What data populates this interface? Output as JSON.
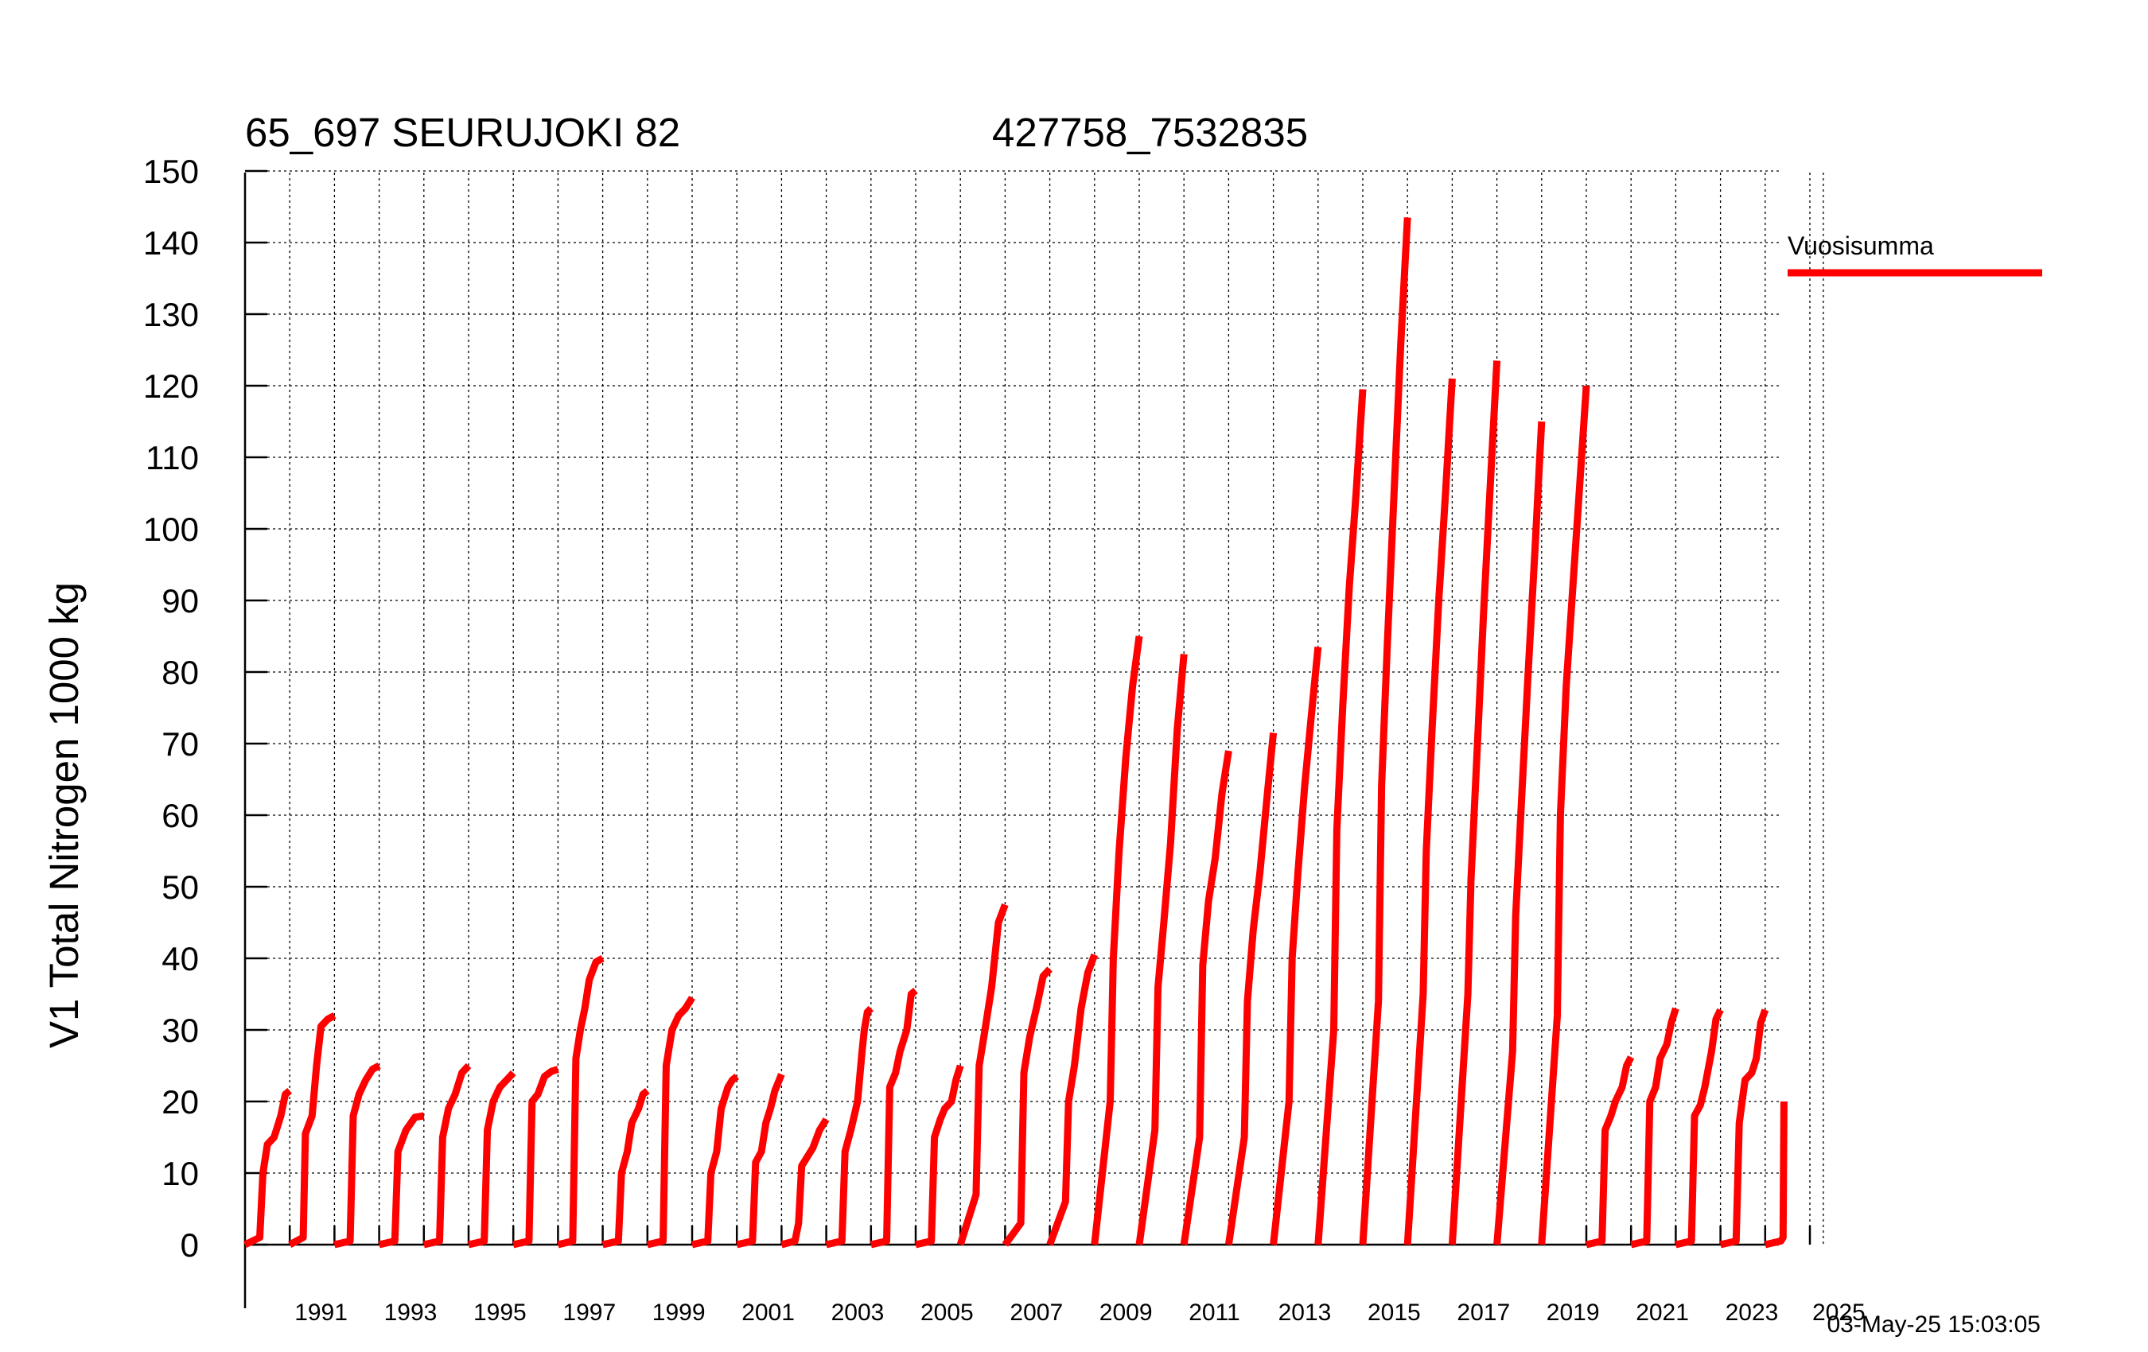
{
  "header": {
    "title_left": "65_697 SEURUJOKI 82",
    "title_right": "427758_7532835"
  },
  "timestamp": "03-May-25 15:03:05",
  "legend": {
    "label": "Vuosisumma",
    "color": "#ff0000",
    "placement": "right"
  },
  "chart_data": {
    "type": "line",
    "title": "65_697 SEURUJOKI 82",
    "ylabel": "V1 Total Nitrogen 1000 kg",
    "xlabel": "",
    "ylim": [
      0,
      150
    ],
    "yticks": [
      0,
      10,
      20,
      30,
      40,
      50,
      60,
      70,
      80,
      90,
      100,
      110,
      120,
      130,
      140,
      150
    ],
    "xlim": [
      1990,
      2025.3
    ],
    "xtick_labels": [
      "1991",
      "1993",
      "1995",
      "1997",
      "1999",
      "2001",
      "2003",
      "2005",
      "2007",
      "2009",
      "2011",
      "2013",
      "2015",
      "2017",
      "2019",
      "2021",
      "2023",
      "2025"
    ],
    "grid": true,
    "series": [
      {
        "name": "Vuosisumma",
        "color": "#ff0000",
        "description_of_x": "decimal year",
        "segments": [
          [
            [
              1990.0,
              0
            ],
            [
              1990.33,
              1
            ],
            [
              1990.4,
              10
            ],
            [
              1990.5,
              14
            ],
            [
              1990.65,
              15
            ],
            [
              1990.8,
              18
            ],
            [
              1990.9,
              21
            ],
            [
              1991.0,
              21.5
            ]
          ],
          [
            [
              1991.0,
              0
            ],
            [
              1991.3,
              1
            ],
            [
              1991.35,
              15.5
            ],
            [
              1991.5,
              18
            ],
            [
              1991.6,
              25
            ],
            [
              1991.7,
              30.5
            ],
            [
              1991.85,
              31.5
            ],
            [
              1992.0,
              32
            ]
          ],
          [
            [
              1992.0,
              0
            ],
            [
              1992.35,
              0.5
            ],
            [
              1992.42,
              18
            ],
            [
              1992.55,
              21
            ],
            [
              1992.7,
              23
            ],
            [
              1992.85,
              24.5
            ],
            [
              1993.0,
              25
            ]
          ],
          [
            [
              1993.0,
              0
            ],
            [
              1993.35,
              0.5
            ],
            [
              1993.42,
              13
            ],
            [
              1993.6,
              16
            ],
            [
              1993.8,
              17.8
            ],
            [
              1994.0,
              18
            ]
          ],
          [
            [
              1994.0,
              0
            ],
            [
              1994.35,
              0.5
            ],
            [
              1994.42,
              15
            ],
            [
              1994.55,
              19
            ],
            [
              1994.7,
              21
            ],
            [
              1994.85,
              24
            ],
            [
              1995.0,
              25
            ]
          ],
          [
            [
              1995.0,
              0
            ],
            [
              1995.35,
              0.5
            ],
            [
              1995.42,
              16
            ],
            [
              1995.55,
              20
            ],
            [
              1995.7,
              22
            ],
            [
              1995.85,
              23
            ],
            [
              1996.0,
              24
            ]
          ],
          [
            [
              1996.0,
              0
            ],
            [
              1996.35,
              0.5
            ],
            [
              1996.42,
              20
            ],
            [
              1996.55,
              21
            ],
            [
              1996.7,
              23.5
            ],
            [
              1996.85,
              24.2
            ],
            [
              1997.0,
              24.5
            ]
          ],
          [
            [
              1997.0,
              0
            ],
            [
              1997.33,
              0.5
            ],
            [
              1997.4,
              26
            ],
            [
              1997.5,
              30
            ],
            [
              1997.6,
              33
            ],
            [
              1997.7,
              37
            ],
            [
              1997.85,
              39.5
            ],
            [
              1998.0,
              40
            ]
          ],
          [
            [
              1998.0,
              0
            ],
            [
              1998.35,
              0.5
            ],
            [
              1998.42,
              10
            ],
            [
              1998.55,
              13
            ],
            [
              1998.65,
              17
            ],
            [
              1998.8,
              19
            ],
            [
              1998.9,
              21
            ],
            [
              1999.0,
              21.5
            ]
          ],
          [
            [
              1999.0,
              0
            ],
            [
              1999.35,
              0.5
            ],
            [
              1999.42,
              25
            ],
            [
              1999.55,
              30
            ],
            [
              1999.7,
              32
            ],
            [
              1999.85,
              33
            ],
            [
              2000.0,
              34.5
            ]
          ],
          [
            [
              2000.0,
              0
            ],
            [
              2000.35,
              0.5
            ],
            [
              2000.42,
              10
            ],
            [
              2000.55,
              13
            ],
            [
              2000.65,
              19
            ],
            [
              2000.8,
              22
            ],
            [
              2000.9,
              23
            ],
            [
              2001.0,
              23.5
            ]
          ],
          [
            [
              2001.0,
              0
            ],
            [
              2001.35,
              0.5
            ],
            [
              2001.42,
              11.5
            ],
            [
              2001.55,
              13
            ],
            [
              2001.65,
              17
            ],
            [
              2001.75,
              19
            ],
            [
              2001.85,
              21.5
            ],
            [
              2002.0,
              23.8
            ]
          ],
          [
            [
              2002.0,
              0
            ],
            [
              2002.3,
              0.5
            ],
            [
              2002.38,
              3
            ],
            [
              2002.45,
              11
            ],
            [
              2002.55,
              12
            ],
            [
              2002.7,
              13.5
            ],
            [
              2002.85,
              16
            ],
            [
              2003.0,
              17.5
            ]
          ],
          [
            [
              2003.0,
              0
            ],
            [
              2003.35,
              0.5
            ],
            [
              2003.42,
              13
            ],
            [
              2003.55,
              16
            ],
            [
              2003.7,
              20
            ],
            [
              2003.8,
              27
            ],
            [
              2003.85,
              30
            ],
            [
              2003.92,
              32.5
            ],
            [
              2004.0,
              33
            ]
          ],
          [
            [
              2004.0,
              0
            ],
            [
              2004.35,
              0.5
            ],
            [
              2004.42,
              22
            ],
            [
              2004.55,
              24
            ],
            [
              2004.65,
              27
            ],
            [
              2004.8,
              30
            ],
            [
              2004.9,
              35
            ],
            [
              2005.0,
              35.5
            ]
          ],
          [
            [
              2005.0,
              0
            ],
            [
              2005.35,
              0.5
            ],
            [
              2005.42,
              15
            ],
            [
              2005.55,
              17.5
            ],
            [
              2005.65,
              19
            ],
            [
              2005.8,
              20
            ],
            [
              2005.9,
              23
            ],
            [
              2006.0,
              25
            ]
          ],
          [
            [
              2006.0,
              0
            ],
            [
              2006.35,
              7
            ],
            [
              2006.42,
              25
            ],
            [
              2006.55,
              30
            ],
            [
              2006.7,
              36
            ],
            [
              2006.85,
              45
            ],
            [
              2007.0,
              47.5
            ]
          ],
          [
            [
              2007.0,
              0
            ],
            [
              2007.35,
              3
            ],
            [
              2007.42,
              24
            ],
            [
              2007.55,
              29
            ],
            [
              2007.7,
              33
            ],
            [
              2007.85,
              37.5
            ],
            [
              2008.0,
              38.5
            ]
          ],
          [
            [
              2008.0,
              0
            ],
            [
              2008.35,
              6
            ],
            [
              2008.42,
              20
            ],
            [
              2008.55,
              25
            ],
            [
              2008.7,
              33
            ],
            [
              2008.85,
              38
            ],
            [
              2009.0,
              40.5
            ]
          ],
          [
            [
              2009.0,
              0
            ],
            [
              2009.35,
              20
            ],
            [
              2009.42,
              40
            ],
            [
              2009.55,
              55
            ],
            [
              2009.7,
              68
            ],
            [
              2009.85,
              78
            ],
            [
              2010.0,
              85
            ]
          ],
          [
            [
              2010.0,
              0
            ],
            [
              2010.35,
              16
            ],
            [
              2010.42,
              36
            ],
            [
              2010.55,
              45
            ],
            [
              2010.7,
              56
            ],
            [
              2010.85,
              72
            ],
            [
              2011.0,
              82.5
            ]
          ],
          [
            [
              2011.0,
              0
            ],
            [
              2011.35,
              15
            ],
            [
              2011.42,
              39
            ],
            [
              2011.55,
              48
            ],
            [
              2011.7,
              54
            ],
            [
              2011.85,
              63
            ],
            [
              2012.0,
              69
            ]
          ],
          [
            [
              2012.0,
              0
            ],
            [
              2012.35,
              15
            ],
            [
              2012.42,
              34
            ],
            [
              2012.55,
              44
            ],
            [
              2012.7,
              52
            ],
            [
              2012.85,
              62
            ],
            [
              2013.0,
              71.5
            ]
          ],
          [
            [
              2013.0,
              0
            ],
            [
              2013.35,
              20
            ],
            [
              2013.42,
              40
            ],
            [
              2013.55,
              52
            ],
            [
              2013.7,
              64
            ],
            [
              2013.85,
              74
            ],
            [
              2014.0,
              83.5
            ]
          ],
          [
            [
              2014.0,
              0
            ],
            [
              2014.35,
              30
            ],
            [
              2014.42,
              58
            ],
            [
              2014.55,
              75
            ],
            [
              2014.7,
              92
            ],
            [
              2014.85,
              105
            ],
            [
              2015.0,
              119.5
            ]
          ],
          [
            [
              2015.0,
              0
            ],
            [
              2015.35,
              34
            ],
            [
              2015.42,
              64
            ],
            [
              2015.55,
              84
            ],
            [
              2015.7,
              105
            ],
            [
              2015.85,
              126
            ],
            [
              2016.0,
              143.5
            ]
          ],
          [
            [
              2016.0,
              0
            ],
            [
              2016.35,
              35
            ],
            [
              2016.42,
              55
            ],
            [
              2016.55,
              72
            ],
            [
              2016.7,
              90
            ],
            [
              2016.85,
              105
            ],
            [
              2017.0,
              121
            ]
          ],
          [
            [
              2017.0,
              0
            ],
            [
              2017.35,
              35
            ],
            [
              2017.42,
              51
            ],
            [
              2017.55,
              68
            ],
            [
              2017.7,
              88
            ],
            [
              2017.85,
              106
            ],
            [
              2018.0,
              123.5
            ]
          ],
          [
            [
              2018.0,
              0
            ],
            [
              2018.35,
              27
            ],
            [
              2018.42,
              46
            ],
            [
              2018.55,
              62
            ],
            [
              2018.7,
              80
            ],
            [
              2018.85,
              97
            ],
            [
              2019.0,
              115
            ]
          ],
          [
            [
              2019.0,
              0
            ],
            [
              2019.35,
              32
            ],
            [
              2019.42,
              60
            ],
            [
              2019.55,
              78
            ],
            [
              2019.7,
              92
            ],
            [
              2019.85,
              106
            ],
            [
              2020.0,
              120
            ]
          ],
          [
            [
              2020.0,
              0
            ],
            [
              2020.35,
              0.5
            ],
            [
              2020.42,
              16
            ],
            [
              2020.55,
              18
            ],
            [
              2020.65,
              20
            ],
            [
              2020.8,
              22
            ],
            [
              2020.9,
              25
            ],
            [
              2021.0,
              26.2
            ]
          ],
          [
            [
              2021.0,
              0
            ],
            [
              2021.35,
              0.5
            ],
            [
              2021.42,
              20
            ],
            [
              2021.55,
              22
            ],
            [
              2021.65,
              26
            ],
            [
              2021.8,
              28
            ],
            [
              2021.9,
              31
            ],
            [
              2022.0,
              33
            ]
          ],
          [
            [
              2022.0,
              0
            ],
            [
              2022.35,
              0.5
            ],
            [
              2022.42,
              18
            ],
            [
              2022.55,
              19.5
            ],
            [
              2022.65,
              22
            ],
            [
              2022.8,
              27
            ],
            [
              2022.9,
              31.5
            ],
            [
              2023.0,
              32.8
            ]
          ],
          [
            [
              2023.0,
              0
            ],
            [
              2023.35,
              0.5
            ],
            [
              2023.42,
              17
            ],
            [
              2023.55,
              23
            ],
            [
              2023.7,
              24
            ],
            [
              2023.8,
              26
            ],
            [
              2023.9,
              31
            ],
            [
              2024.0,
              32.8
            ]
          ],
          [
            [
              2024.0,
              0
            ],
            [
              2024.35,
              0.5
            ],
            [
              2024.4,
              1
            ],
            [
              2024.42,
              20
            ]
          ]
        ]
      }
    ]
  }
}
